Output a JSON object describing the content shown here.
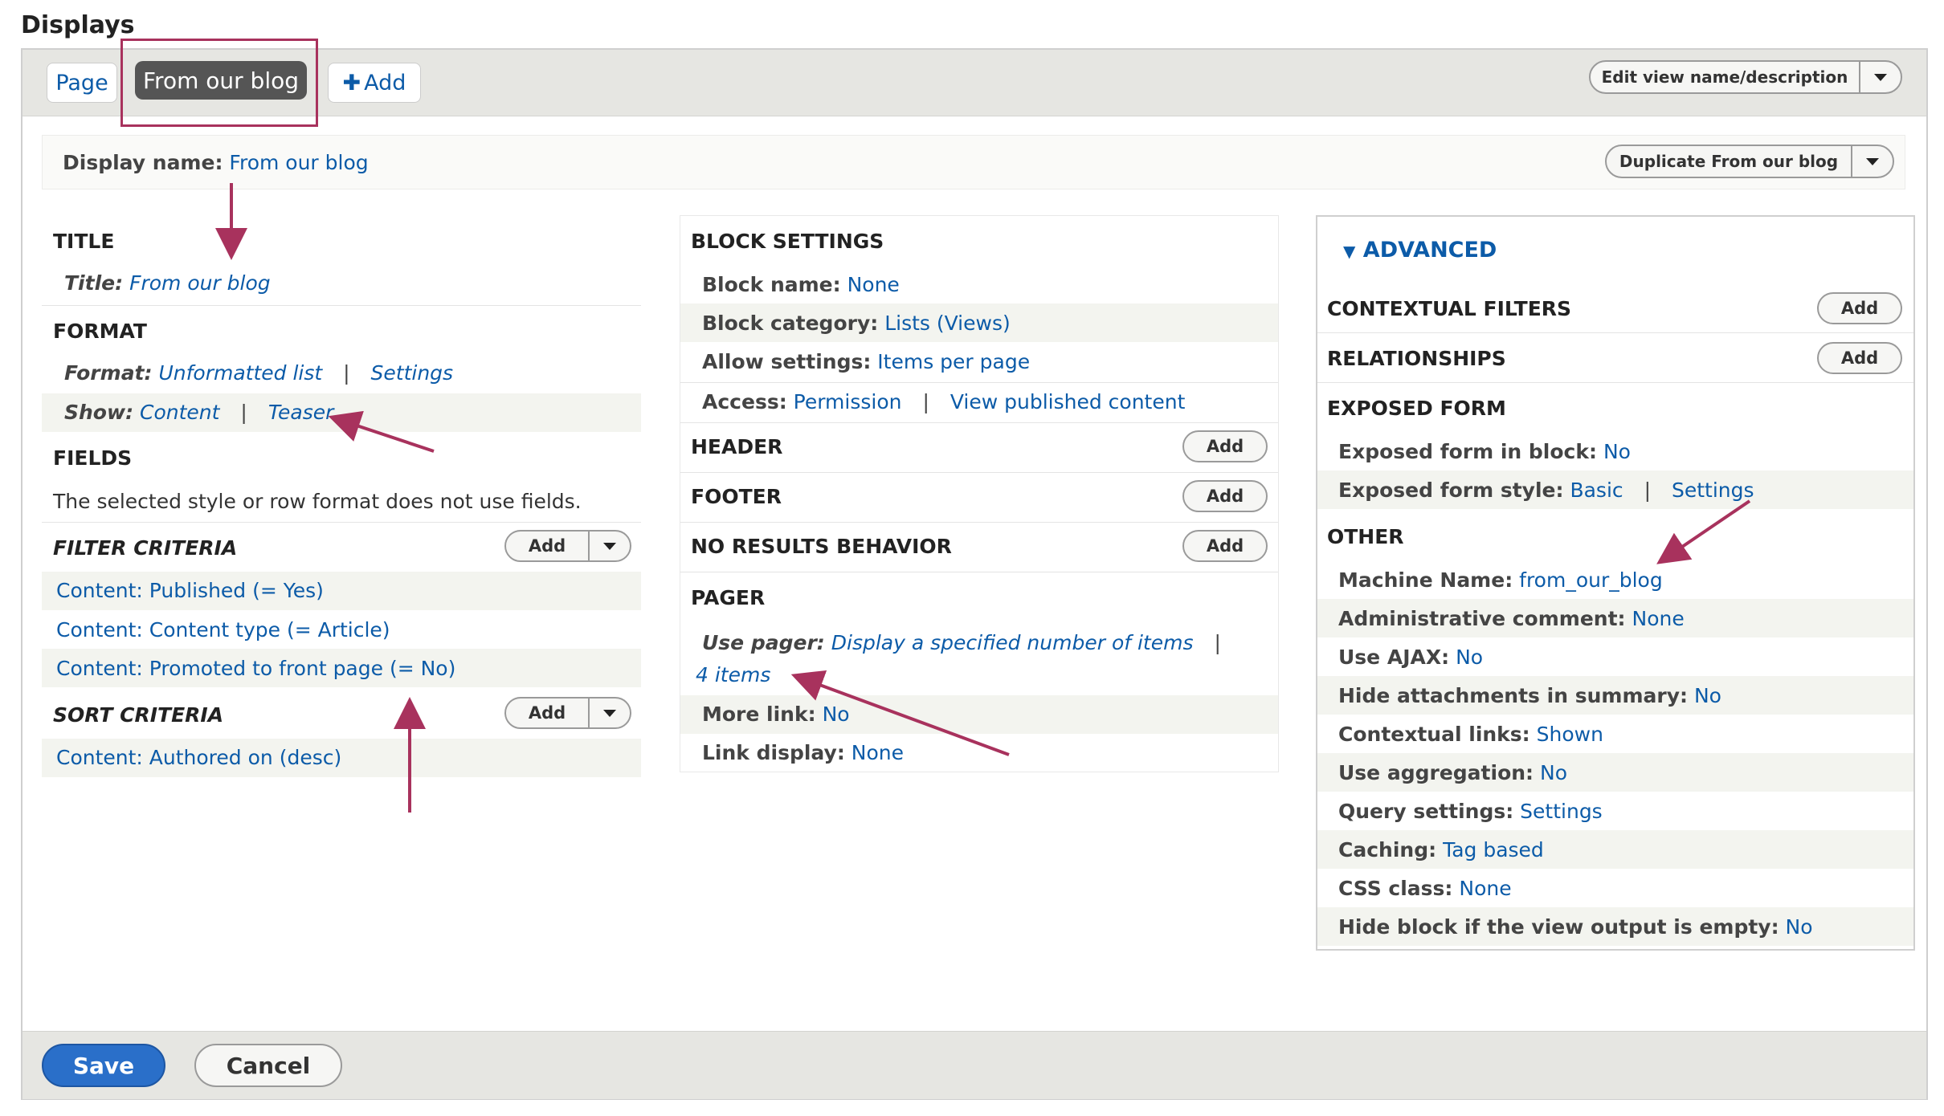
{
  "page_title": "Displays",
  "tabs": [
    {
      "label": "Page",
      "active": false
    },
    {
      "label": "From our blog",
      "active": true
    }
  ],
  "add_tab": {
    "icon": "plus-icon",
    "label": "Add"
  },
  "edit_view_button": "Edit view name/description",
  "display_name": {
    "label": "Display name:",
    "value": "From our blog"
  },
  "duplicate_button": "Duplicate From our blog",
  "col1": {
    "title": {
      "heading": "TITLE",
      "label": "Title:",
      "value": "From our blog"
    },
    "format": {
      "heading": "FORMAT",
      "format_label": "Format:",
      "format_value": "Unformatted list",
      "format_settings": "Settings",
      "show_label": "Show:",
      "show_value": "Content",
      "show_settings": "Teaser"
    },
    "fields": {
      "heading": "FIELDS",
      "note": "The selected style or row format does not use fields."
    },
    "filter": {
      "heading": "FILTER CRITERIA",
      "add": "Add",
      "items": [
        "Content: Published (= Yes)",
        "Content: Content type (= Article)",
        "Content: Promoted to front page (= No)"
      ]
    },
    "sort": {
      "heading": "SORT CRITERIA",
      "add": "Add",
      "items": [
        "Content: Authored on (desc)"
      ]
    }
  },
  "col2": {
    "block_settings": {
      "heading": "BLOCK SETTINGS",
      "block_name_label": "Block name:",
      "block_name_value": "None",
      "block_category_label": "Block category:",
      "block_category_value": "Lists (Views)",
      "allow_settings_label": "Allow settings:",
      "allow_settings_value": "Items per page",
      "access_label": "Access:",
      "access_value": "Permission",
      "access_value2": "View published content"
    },
    "header": {
      "heading": "HEADER",
      "add": "Add"
    },
    "footer": {
      "heading": "FOOTER",
      "add": "Add"
    },
    "no_results": {
      "heading": "NO RESULTS BEHAVIOR",
      "add": "Add"
    },
    "pager": {
      "heading": "PAGER",
      "use_pager_label": "Use pager:",
      "use_pager_value": "Display a specified number of items",
      "use_pager_items": "4 items",
      "more_link_label": "More link:",
      "more_link_value": "No",
      "link_display_label": "Link display:",
      "link_display_value": "None"
    }
  },
  "col3": {
    "advanced": "ADVANCED",
    "contextual_filters": {
      "heading": "CONTEXTUAL FILTERS",
      "add": "Add"
    },
    "relationships": {
      "heading": "RELATIONSHIPS",
      "add": "Add"
    },
    "exposed_form": {
      "heading": "EXPOSED FORM",
      "in_block_label": "Exposed form in block:",
      "in_block_value": "No",
      "style_label": "Exposed form style:",
      "style_value": "Basic",
      "style_settings": "Settings"
    },
    "other": {
      "heading": "OTHER",
      "rows": [
        {
          "label": "Machine Name:",
          "value": "from_our_blog"
        },
        {
          "label": "Administrative comment:",
          "value": "None"
        },
        {
          "label": "Use AJAX:",
          "value": "No"
        },
        {
          "label": "Hide attachments in summary:",
          "value": "No"
        },
        {
          "label": "Contextual links:",
          "value": "Shown"
        },
        {
          "label": "Use aggregation:",
          "value": "No"
        },
        {
          "label": "Query settings:",
          "value": "Settings"
        },
        {
          "label": "Caching:",
          "value": "Tag based"
        },
        {
          "label": "CSS class:",
          "value": "None"
        },
        {
          "label": "Hide block if the view output is empty:",
          "value": "No"
        }
      ]
    }
  },
  "footer_buttons": {
    "save": "Save",
    "cancel": "Cancel"
  },
  "colors": {
    "accent": "#0c5ba8",
    "annotation": "#a8325d",
    "primary_button": "#2a6fc9"
  }
}
